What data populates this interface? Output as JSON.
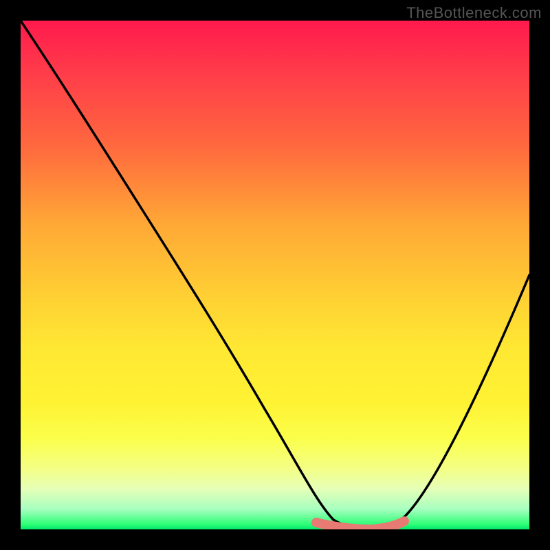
{
  "watermark": "TheBottleneck.com",
  "chart_data": {
    "type": "line",
    "title": "",
    "xlabel": "",
    "ylabel": "",
    "xlim": [
      0,
      100
    ],
    "ylim": [
      0,
      100
    ],
    "series": [
      {
        "name": "bottleneck-curve",
        "x": [
          0,
          5,
          10,
          15,
          20,
          25,
          30,
          35,
          40,
          45,
          50,
          55,
          60,
          62,
          65,
          68,
          70,
          72,
          75,
          80,
          85,
          90,
          95,
          100
        ],
        "values": [
          100,
          93,
          86,
          79,
          72,
          64,
          56,
          48,
          39,
          31,
          22,
          13,
          5,
          2,
          1,
          1,
          1,
          2,
          5,
          12,
          20,
          29,
          39,
          50
        ]
      },
      {
        "name": "highlight-band",
        "x": [
          58,
          61,
          64,
          67,
          70,
          72
        ],
        "values": [
          2,
          1,
          1,
          1,
          1,
          2
        ]
      }
    ],
    "gradient_stops": [
      {
        "pos": 0,
        "color": "#ff1a4d"
      },
      {
        "pos": 25,
        "color": "#ff6a3e"
      },
      {
        "pos": 55,
        "color": "#ffd233"
      },
      {
        "pos": 82,
        "color": "#fbff4a"
      },
      {
        "pos": 96,
        "color": "#a8ffc0"
      },
      {
        "pos": 100,
        "color": "#00e86b"
      }
    ]
  }
}
